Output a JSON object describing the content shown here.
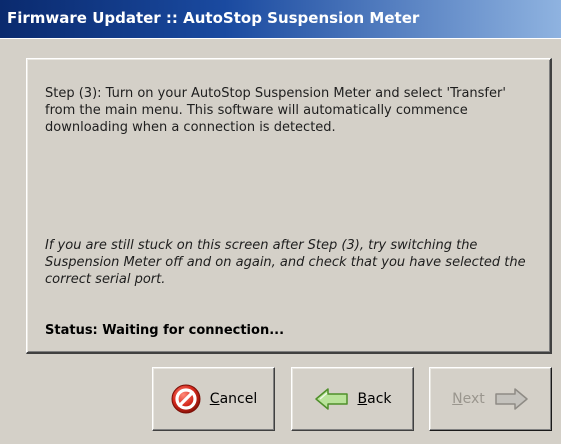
{
  "window": {
    "title": "Firmware Updater :: AutoStop Suspension Meter"
  },
  "main": {
    "step_text": "Step (3): Turn on your AutoStop Suspension Meter and select 'Transfer' from the main menu.  This software will automatically commence downloading when a connection is detected.",
    "hint_text": "If you are still stuck on this screen after Step (3), try switching the Suspension Meter off and on again, and check that you have selected the correct serial port.",
    "status_text": "Status: Waiting for connection..."
  },
  "buttons": {
    "cancel": {
      "mnemonic": "C",
      "rest": "ancel",
      "enabled": true
    },
    "back": {
      "mnemonic": "B",
      "rest": "ack",
      "enabled": true
    },
    "next": {
      "mnemonic": "N",
      "rest": "ext",
      "enabled": false
    }
  },
  "icons": {
    "cancel": "cancel-icon",
    "back": "arrow-left-icon",
    "next": "arrow-right-icon"
  },
  "colors": {
    "titlebar_start": "#0a2a6e",
    "titlebar_end": "#8fb3e0",
    "cancel_icon": "#d62a1e",
    "back_arrow": "#7ec94a",
    "disabled_text": "#9a968e",
    "panel_bg": "#d4d0c8"
  }
}
